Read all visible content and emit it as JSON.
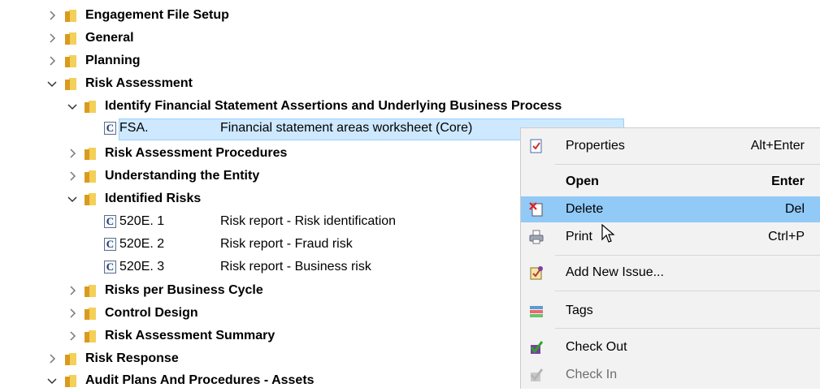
{
  "tree": {
    "folders": [
      {
        "label": "Engagement File Setup",
        "expanded": false
      },
      {
        "label": "General",
        "expanded": false
      },
      {
        "label": "Planning",
        "expanded": false
      },
      {
        "label": "Risk Assessment",
        "expanded": true
      },
      {
        "label": "Identify Financial Statement Assertions and Underlying Business Process",
        "expanded": true
      },
      {
        "label": "Risk Assessment Procedures",
        "expanded": false
      },
      {
        "label": "Understanding the Entity",
        "expanded": false
      },
      {
        "label": "Identified Risks",
        "expanded": true
      },
      {
        "label": "Risks per Business Cycle",
        "expanded": false
      },
      {
        "label": "Control Design",
        "expanded": false
      },
      {
        "label": "Risk Assessment Summary",
        "expanded": false
      },
      {
        "label": "Risk Response",
        "expanded": false
      },
      {
        "label": "Audit Plans And Procedures - Assets",
        "expanded": true
      }
    ],
    "documents": [
      {
        "icon_letter": "C",
        "code": "FSA.",
        "description": "Financial statement areas worksheet (Core)",
        "selected": true
      },
      {
        "icon_letter": "C",
        "code": "520E. 1",
        "description": "Risk report - Risk identification",
        "selected": false
      },
      {
        "icon_letter": "C",
        "code": "520E. 2",
        "description": "Risk report - Fraud risk",
        "selected": false
      },
      {
        "icon_letter": "C",
        "code": "520E. 3",
        "description": "Risk report - Business risk",
        "selected": false
      }
    ]
  },
  "context_menu": {
    "items": [
      {
        "label": "Properties",
        "shortcut": "Alt+Enter",
        "icon": "properties-icon"
      },
      {
        "label": "Open",
        "shortcut": "Enter",
        "icon": ""
      },
      {
        "label": "Delete",
        "shortcut": "Del",
        "icon": "delete-icon",
        "highlighted": true
      },
      {
        "label": "Print",
        "shortcut": "Ctrl+P",
        "icon": "print-icon"
      },
      {
        "label": "Add New Issue...",
        "shortcut": "",
        "icon": "add-issue-icon"
      },
      {
        "label": "Tags",
        "shortcut": "",
        "icon": "tags-icon"
      },
      {
        "label": "Check Out",
        "shortcut": "",
        "icon": "check-out-icon"
      },
      {
        "label": "Check In",
        "shortcut": "",
        "icon": "check-in-icon",
        "disabled": true
      }
    ]
  },
  "colors": {
    "selection": "#cde8ff",
    "menu_highlight": "#91c9f7",
    "folder": "#e8b830"
  }
}
